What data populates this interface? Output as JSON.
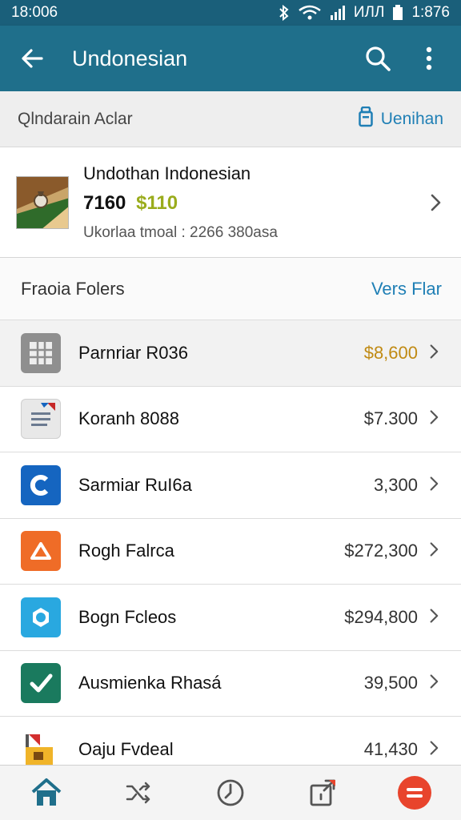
{
  "status_bar": {
    "time_left": "18:006",
    "battery_text": "ИЛЛ",
    "time_right": "1:876",
    "icons": [
      "bluetooth-icon",
      "wifi-icon",
      "signal-icon",
      "battery-icon"
    ]
  },
  "app_bar": {
    "title": "Undonesian",
    "icons": [
      "back-arrow-icon",
      "search-icon",
      "more-vert-icon"
    ]
  },
  "filter_bar": {
    "label": "Qlndarain Aclar",
    "link_label": "Uenihan",
    "link_icon": "lock-icon"
  },
  "summary": {
    "title": "Undothan Indonesian",
    "amount": "7160",
    "gain": "$110",
    "subtitle": "Ukorlaa tmoal : 2266 380asa",
    "colors": {
      "gain": "#9aac1c"
    }
  },
  "section": {
    "label": "Fraoia Folers",
    "link": "Vers Flar"
  },
  "list": [
    {
      "label": "Parnriar R036",
      "value": "$8,600",
      "icon": "grid-icon",
      "color": "#8f8f8f"
    },
    {
      "label": "Koranh 8088",
      "value": "$7.300",
      "icon": "document-icon",
      "color": "#e0e0e0"
    },
    {
      "label": "Sarmiar RuI6a",
      "value": "3,300",
      "icon": "c-logo-icon",
      "color": "#1565c0"
    },
    {
      "label": "Rogh Falrca",
      "value": "$272,300",
      "icon": "triangle-icon",
      "color": "#ef6c27"
    },
    {
      "label": "Bogn Fcleos",
      "value": "$294,800",
      "icon": "ring-icon",
      "color": "#29a8e0"
    },
    {
      "label": "Ausmienka Rhasá",
      "value": "39,500",
      "icon": "check-icon",
      "color": "#1a7a5e"
    },
    {
      "label": "Oaju Fvdeal",
      "value": "41,430",
      "icon": "flag-icon",
      "color": "#f0b429"
    }
  ],
  "bottom_nav": {
    "items": [
      "home-icon",
      "shuffle-icon",
      "clock-icon",
      "share-icon",
      "menu-circle-icon"
    ],
    "colors": {
      "active": "#1f6f8b",
      "fab": "#e8442c"
    }
  }
}
